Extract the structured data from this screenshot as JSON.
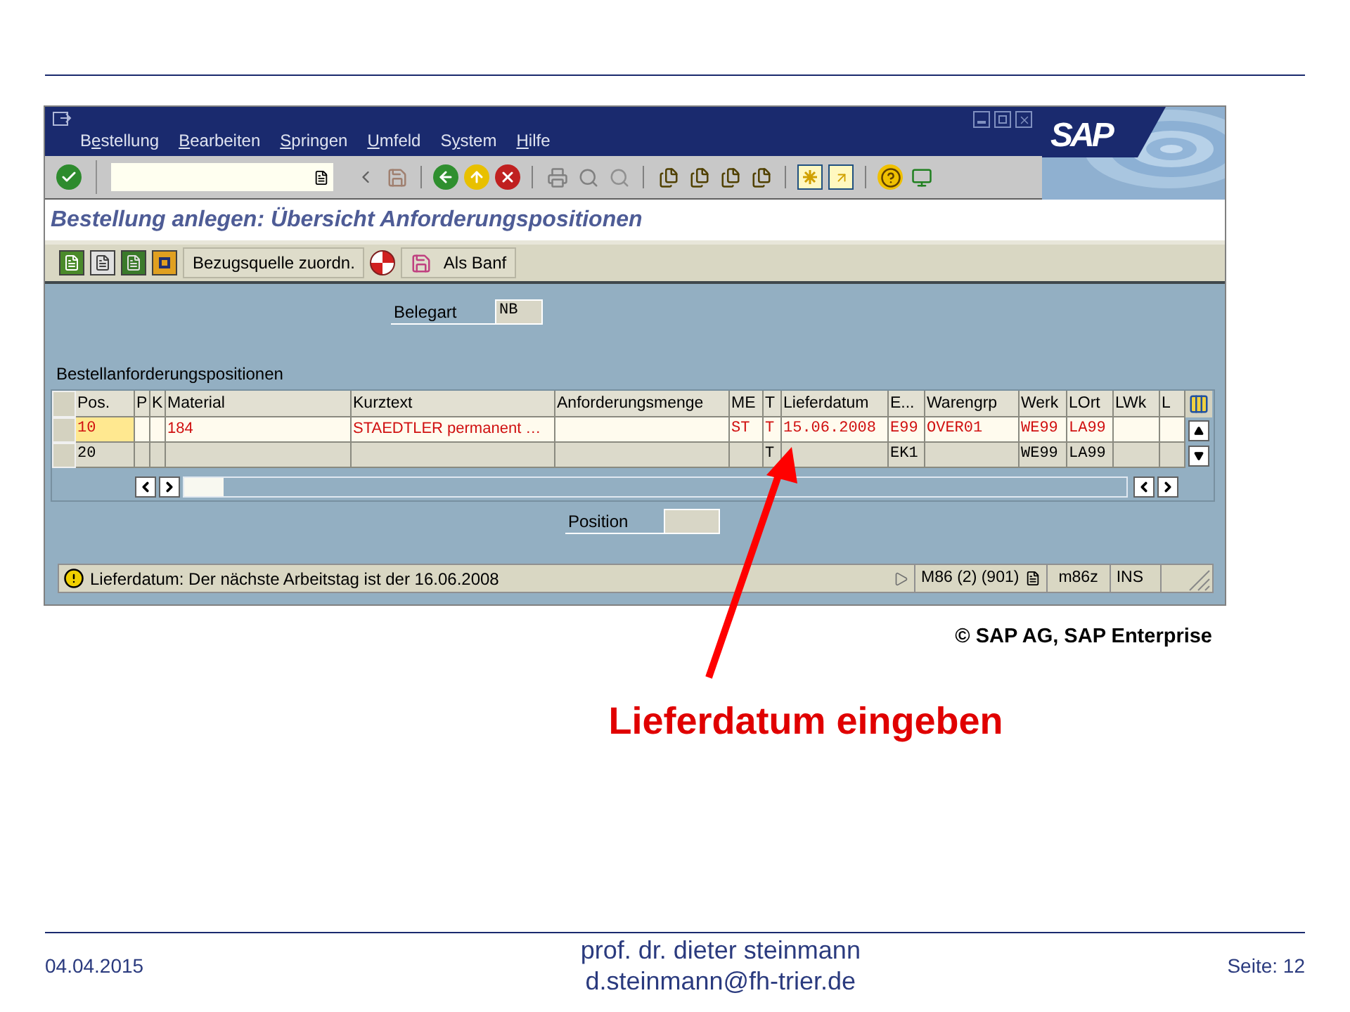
{
  "sap_window": {
    "menu": [
      {
        "before": "B",
        "hotkey": "e",
        "after": "stellung"
      },
      {
        "hotkey": "B",
        "after": "earbeiten"
      },
      {
        "hotkey": "S",
        "after": "pringen"
      },
      {
        "hotkey": "U",
        "after": "mfeld"
      },
      {
        "before": "S",
        "hotkey": "y",
        "after": "stem"
      },
      {
        "hotkey": "H",
        "after": "ilfe"
      }
    ],
    "logo": "SAP",
    "screen_title": "Bestellung anlegen: Übersicht Anforderungspositionen",
    "app_buttons": [
      {
        "label": "Bezugsquelle zuordn."
      },
      {
        "label": "Als Banf"
      }
    ],
    "belegart": {
      "label": "Belegart",
      "value": "NB"
    },
    "table": {
      "title": "Bestellanforderungspositionen",
      "columns": [
        "Pos.",
        "P",
        "K",
        "Material",
        "Kurztext",
        "Anforderungsmenge",
        "ME",
        "T",
        "Lieferdatum",
        "E...",
        "Warengrp",
        "Werk",
        "LOrt",
        "LWk",
        "L"
      ],
      "rows": [
        {
          "error": true,
          "current": true,
          "cells": [
            "10",
            null,
            null,
            "184",
            "STAEDTLER permanent …",
            null,
            "ST",
            "T",
            "15.06.2008",
            "E99",
            "OVER01",
            "WE99",
            "LA99",
            null,
            null
          ]
        },
        {
          "error": false,
          "current": false,
          "cells": [
            "20",
            null,
            null,
            null,
            null,
            null,
            null,
            "T",
            null,
            "EK1",
            null,
            "WE99",
            "LA99",
            null,
            null
          ]
        }
      ]
    },
    "position": {
      "label": "Position"
    },
    "status_bar": {
      "message": "Lieferdatum: Der nächste Arbeitstag ist der 16.06.2008",
      "system": "M86 (2) (901)",
      "client": "m86z",
      "mode": "INS"
    }
  },
  "copyright": "© SAP AG, SAP Enterprise",
  "annotation": "Lieferdatum eingeben",
  "footer": {
    "date": "04.04.2015",
    "author": "prof. dr. dieter steinmann",
    "email": "d.steinmann@fh-trier.de",
    "page": "Seite: 12"
  }
}
